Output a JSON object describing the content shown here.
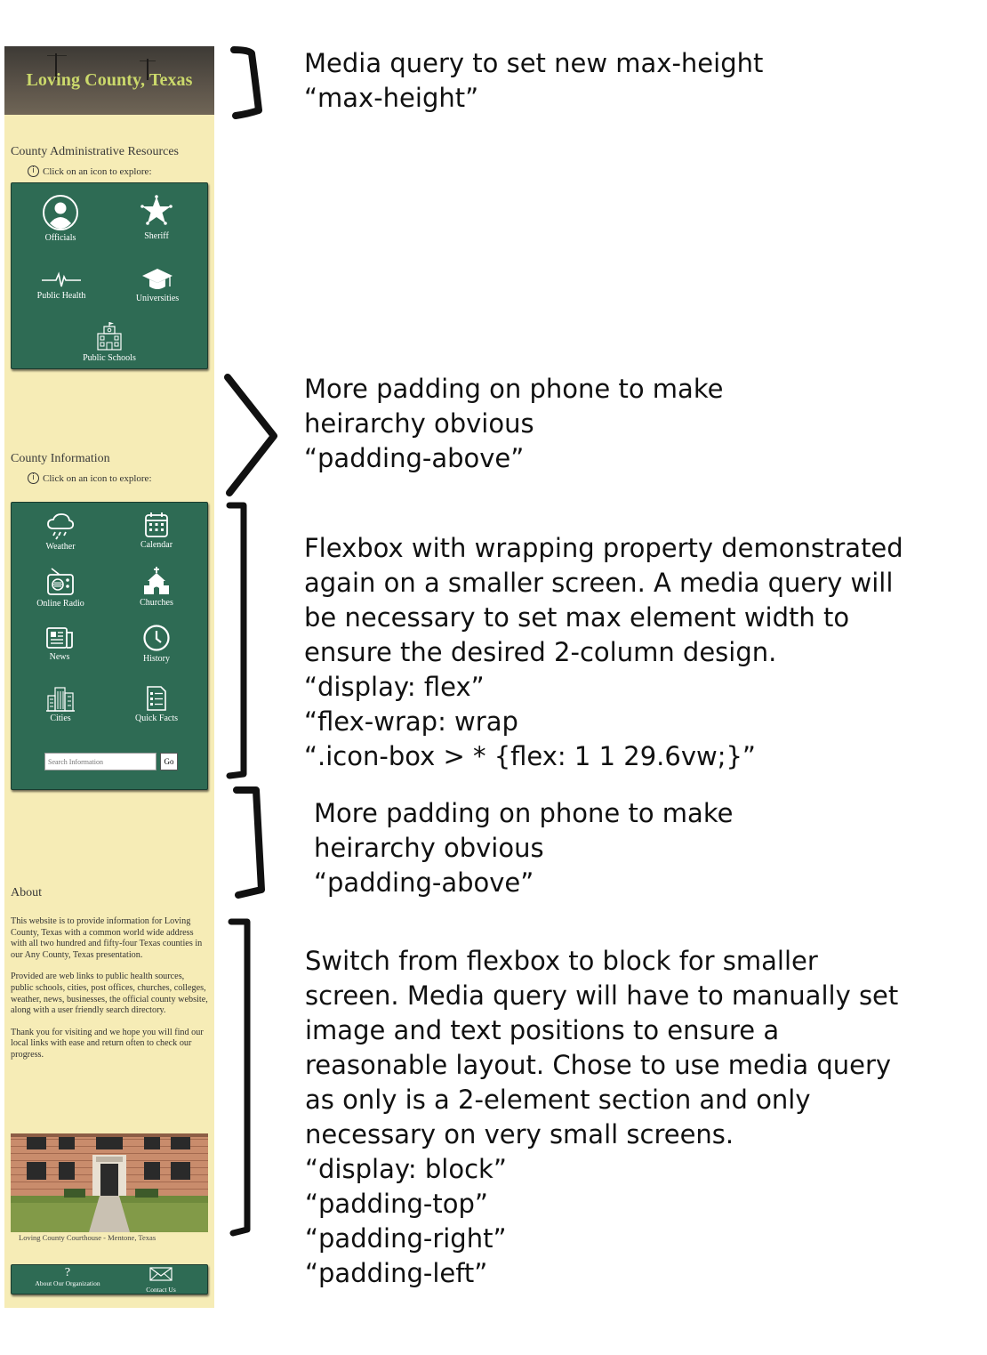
{
  "hero": {
    "title": "Loving County, Texas"
  },
  "admin_section": {
    "title": "County Administrative Resources",
    "hint": "Click on an icon to explore:",
    "tiles": [
      {
        "label": "Officials",
        "icon": "person-icon"
      },
      {
        "label": "Sheriff",
        "icon": "star-badge-icon"
      },
      {
        "label": "Public Health",
        "icon": "heartbeat-icon"
      },
      {
        "label": "Universities",
        "icon": "graduation-cap-icon"
      },
      {
        "label": "Public Schools",
        "icon": "school-building-icon"
      }
    ]
  },
  "info_section": {
    "title": "County Information",
    "hint": "Click on an icon to explore:",
    "tiles": [
      {
        "label": "Weather",
        "icon": "rain-cloud-icon"
      },
      {
        "label": "Calendar",
        "icon": "calendar-icon"
      },
      {
        "label": "Online Radio",
        "icon": "radio-icon"
      },
      {
        "label": "Churches",
        "icon": "church-icon"
      },
      {
        "label": "News",
        "icon": "newspaper-icon"
      },
      {
        "label": "History",
        "icon": "clock-icon"
      },
      {
        "label": "Cities",
        "icon": "city-icon"
      },
      {
        "label": "Quick Facts",
        "icon": "document-list-icon"
      }
    ],
    "search_placeholder": "Search Information",
    "go_label": "Go"
  },
  "about_section": {
    "title": "About",
    "paragraphs": [
      "This website is to provide information for Loving County, Texas with a common  world wide address with all two hundred and fifty-four Texas counties in our  Any County, Texas presentation.",
      "Provided are web links to public health sources,  public schools, cities, post offices, churches,  colleges, weather, news, businesses, the official  county website, along with a user friendly search  directory.",
      "Thank you for visiting and we hope you will find our local links with ease and return often to check our progress."
    ],
    "caption": "Loving County Courthouse - Mentone, Texas"
  },
  "footer": {
    "about_label": "About Our Organization",
    "about_glyph": "?",
    "contact_label": "Contact Us"
  },
  "notes": [
    {
      "lines": [
        "Media query to set new max-height",
        "“max-height”"
      ]
    },
    {
      "lines": [
        "More padding on phone to make",
        "heirarchy obvious",
        "“padding-above”"
      ]
    },
    {
      "lines": [
        "Flexbox with wrapping property demonstrated",
        "again on a smaller screen. A media query will",
        "be necessary to set max element width to",
        "ensure the desired 2-column design.",
        "“display: flex”",
        "“flex-wrap: wrap",
        "“.icon-box > * {flex: 1 1 29.6vw;}”"
      ]
    },
    {
      "lines": [
        "More padding on phone to make",
        "heirarchy obvious",
        "“padding-above”"
      ]
    },
    {
      "lines": [
        "Switch from flexbox to block for smaller",
        "screen. Media query will have to manually set",
        "image and text positions to ensure a",
        "reasonable layout. Chose to use media query",
        "as only is a 2-element section and only",
        "necessary on very small screens.",
        "“display: block”",
        "“padding-top”",
        "“padding-right”",
        "“padding-left”"
      ]
    }
  ],
  "colors": {
    "page_bg": "#f6ecb6",
    "panel_green": "#2e6b54",
    "hero_title": "#cbd96b"
  }
}
